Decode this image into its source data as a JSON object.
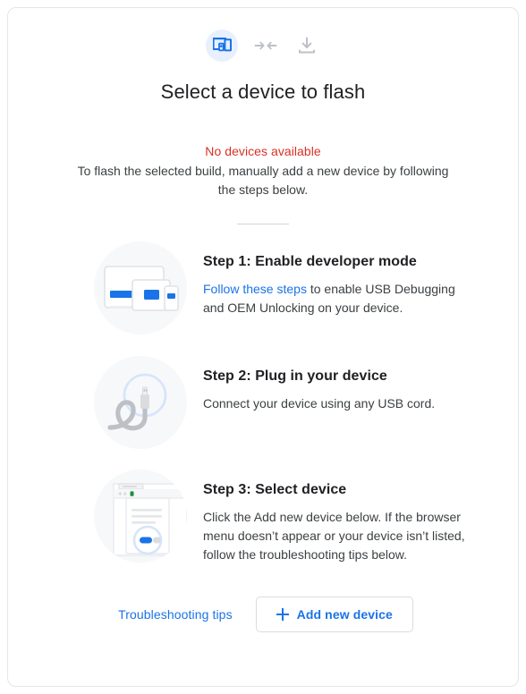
{
  "header": {
    "icons": [
      {
        "name": "devices-icon",
        "label": "devices",
        "color": "#1a73e8",
        "bg": "#e8f0fe"
      },
      {
        "name": "compress-arrows-icon",
        "label": "connect",
        "color": "#bdc1c6"
      },
      {
        "name": "download-icon",
        "label": "download",
        "color": "#bdc1c6"
      }
    ],
    "title": "Select a device to flash"
  },
  "status": {
    "error": "No devices available",
    "error_color": "#d93025",
    "description": "To flash the selected build, manually add a new device by following the steps below."
  },
  "steps": [
    {
      "art": "devices-illustration",
      "title": "Step 1: Enable developer mode",
      "body_link": "Follow these steps",
      "body_rest": " to enable USB Debugging and OEM Unlocking on your device."
    },
    {
      "art": "usb-cable-illustration",
      "title": "Step 2: Plug in your device",
      "body_rest": "Connect your device using any USB cord."
    },
    {
      "art": "browser-menu-illustration",
      "title": "Step 3: Select device",
      "body_rest": "Click the Add new device below. If the browser menu doesn’t appear or your device isn’t listed, follow the troubleshooting tips below."
    }
  ],
  "footer": {
    "troubleshooting_label": "Troubleshooting tips",
    "add_device_label": "Add new device",
    "add_icon": "plus-icon",
    "accent_color": "#1a73e8"
  }
}
